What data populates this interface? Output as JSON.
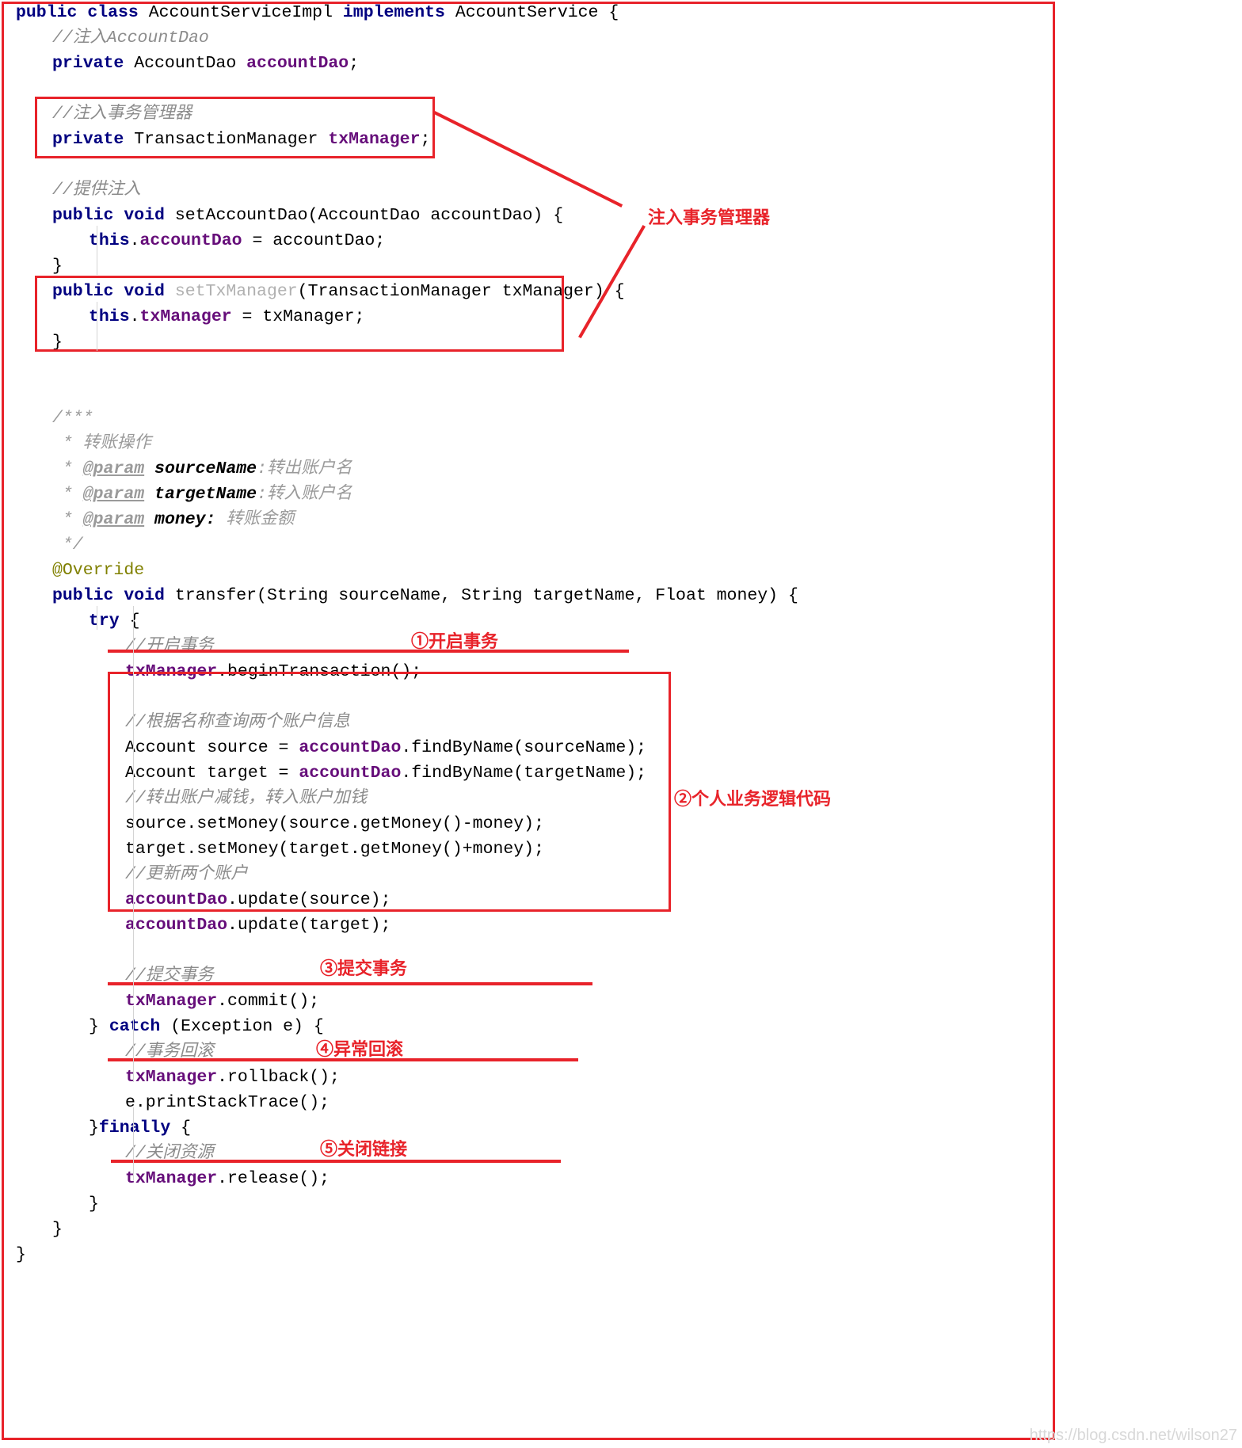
{
  "code_lines": [
    {
      "indent": 0,
      "tokens": [
        {
          "t": "public ",
          "c": "kw"
        },
        {
          "t": "class ",
          "c": "kw"
        },
        {
          "t": "AccountServiceImpl ",
          "c": "plain"
        },
        {
          "t": "implements ",
          "c": "kw"
        },
        {
          "t": "AccountService {",
          "c": "plain"
        }
      ]
    },
    {
      "indent": 1,
      "tokens": [
        {
          "t": "//注入AccountDao",
          "c": "cmt"
        }
      ]
    },
    {
      "indent": 1,
      "tokens": [
        {
          "t": "private ",
          "c": "kw"
        },
        {
          "t": "AccountDao ",
          "c": "plain"
        },
        {
          "t": "accountDao",
          "c": "field"
        },
        {
          "t": ";",
          "c": "plain"
        }
      ]
    },
    {
      "indent": 0,
      "tokens": [
        {
          "t": " ",
          "c": "plain"
        }
      ]
    },
    {
      "indent": 1,
      "tokens": [
        {
          "t": "//注入事务管理器",
          "c": "cmt"
        }
      ]
    },
    {
      "indent": 1,
      "tokens": [
        {
          "t": "private ",
          "c": "kw"
        },
        {
          "t": "TransactionManager ",
          "c": "plain"
        },
        {
          "t": "txManager",
          "c": "field"
        },
        {
          "t": ";",
          "c": "plain"
        }
      ]
    },
    {
      "indent": 0,
      "tokens": [
        {
          "t": " ",
          "c": "plain"
        }
      ]
    },
    {
      "indent": 1,
      "tokens": [
        {
          "t": "//提供注入",
          "c": "cmt"
        }
      ]
    },
    {
      "indent": 1,
      "tokens": [
        {
          "t": "public ",
          "c": "kw"
        },
        {
          "t": "void ",
          "c": "kw"
        },
        {
          "t": "setAccountDao(AccountDao accountDao) {",
          "c": "plain"
        }
      ]
    },
    {
      "indent": 2,
      "tokens": [
        {
          "t": "this",
          "c": "kw"
        },
        {
          "t": ".",
          "c": "plain"
        },
        {
          "t": "accountDao",
          "c": "field"
        },
        {
          "t": " = accountDao;",
          "c": "plain"
        }
      ]
    },
    {
      "indent": 1,
      "tokens": [
        {
          "t": "}",
          "c": "plain"
        }
      ]
    },
    {
      "indent": 1,
      "tokens": [
        {
          "t": "public ",
          "c": "kw"
        },
        {
          "t": "void ",
          "c": "kw"
        },
        {
          "t": "setTxManager",
          "c": "greyed"
        },
        {
          "t": "(TransactionManager txManager) {",
          "c": "plain"
        }
      ]
    },
    {
      "indent": 2,
      "tokens": [
        {
          "t": "this",
          "c": "kw"
        },
        {
          "t": ".",
          "c": "plain"
        },
        {
          "t": "txManager",
          "c": "field"
        },
        {
          "t": " = txManager;",
          "c": "plain"
        }
      ]
    },
    {
      "indent": 1,
      "tokens": [
        {
          "t": "}",
          "c": "plain"
        }
      ]
    },
    {
      "indent": 0,
      "tokens": [
        {
          "t": " ",
          "c": "plain"
        }
      ]
    },
    {
      "indent": 0,
      "tokens": [
        {
          "t": " ",
          "c": "plain"
        }
      ]
    },
    {
      "indent": 1,
      "tokens": [
        {
          "t": "/***",
          "c": "cmtdoc"
        }
      ]
    },
    {
      "indent": 1,
      "tokens": [
        {
          "t": " * 转账操作",
          "c": "cmtdoc"
        }
      ]
    },
    {
      "indent": 1,
      "tokens": [
        {
          "t": " * ",
          "c": "cmtdoc"
        },
        {
          "t": "@param",
          "c": "tag"
        },
        {
          "t": " sourceName",
          "c": "tagtxt"
        },
        {
          "t": ":转出账户名",
          "c": "cmtdoc"
        }
      ]
    },
    {
      "indent": 1,
      "tokens": [
        {
          "t": " * ",
          "c": "cmtdoc"
        },
        {
          "t": "@param",
          "c": "tag"
        },
        {
          "t": " targetName",
          "c": "tagtxt"
        },
        {
          "t": ":转入账户名",
          "c": "cmtdoc"
        }
      ]
    },
    {
      "indent": 1,
      "tokens": [
        {
          "t": " * ",
          "c": "cmtdoc"
        },
        {
          "t": "@param",
          "c": "tag"
        },
        {
          "t": " money:",
          "c": "tagtxt"
        },
        {
          "t": " 转账金额",
          "c": "cmtdoc"
        }
      ]
    },
    {
      "indent": 1,
      "tokens": [
        {
          "t": " */",
          "c": "cmtdoc"
        }
      ]
    },
    {
      "indent": 1,
      "tokens": [
        {
          "t": "@Override",
          "c": "anno"
        }
      ]
    },
    {
      "indent": 1,
      "tokens": [
        {
          "t": "public ",
          "c": "kw"
        },
        {
          "t": "void ",
          "c": "kw"
        },
        {
          "t": "transfer(String sourceName, String targetName, Float money) {",
          "c": "plain"
        }
      ]
    },
    {
      "indent": 2,
      "tokens": [
        {
          "t": "try",
          "c": "kw"
        },
        {
          "t": " {",
          "c": "plain"
        }
      ]
    },
    {
      "indent": 3,
      "tokens": [
        {
          "t": "//开启事务",
          "c": "cmt"
        }
      ]
    },
    {
      "indent": 3,
      "tokens": [
        {
          "t": "txManager",
          "c": "field"
        },
        {
          "t": ".beginTransaction();",
          "c": "plain"
        }
      ]
    },
    {
      "indent": 0,
      "tokens": [
        {
          "t": " ",
          "c": "plain"
        }
      ]
    },
    {
      "indent": 3,
      "tokens": [
        {
          "t": "//根据名称查询两个账户信息",
          "c": "cmt"
        }
      ]
    },
    {
      "indent": 3,
      "tokens": [
        {
          "t": "Account source = ",
          "c": "plain"
        },
        {
          "t": "accountDao",
          "c": "field"
        },
        {
          "t": ".findByName(sourceName);",
          "c": "plain"
        }
      ]
    },
    {
      "indent": 3,
      "tokens": [
        {
          "t": "Account target = ",
          "c": "plain"
        },
        {
          "t": "accountDao",
          "c": "field"
        },
        {
          "t": ".findByName(targetName);",
          "c": "plain"
        }
      ]
    },
    {
      "indent": 3,
      "tokens": [
        {
          "t": "//转出账户减钱，转入账户加钱",
          "c": "cmt"
        }
      ]
    },
    {
      "indent": 3,
      "tokens": [
        {
          "t": "source.setMoney(source.getMoney()-money);",
          "c": "plain"
        }
      ]
    },
    {
      "indent": 3,
      "tokens": [
        {
          "t": "target.setMoney(target.getMoney()+money);",
          "c": "plain"
        }
      ]
    },
    {
      "indent": 3,
      "tokens": [
        {
          "t": "//更新两个账户",
          "c": "cmt"
        }
      ]
    },
    {
      "indent": 3,
      "tokens": [
        {
          "t": "accountDao",
          "c": "field"
        },
        {
          "t": ".update(source);",
          "c": "plain"
        }
      ]
    },
    {
      "indent": 3,
      "tokens": [
        {
          "t": "accountDao",
          "c": "field"
        },
        {
          "t": ".update(target);",
          "c": "plain"
        }
      ]
    },
    {
      "indent": 0,
      "tokens": [
        {
          "t": " ",
          "c": "plain"
        }
      ]
    },
    {
      "indent": 3,
      "tokens": [
        {
          "t": "//提交事务",
          "c": "cmt"
        }
      ]
    },
    {
      "indent": 3,
      "tokens": [
        {
          "t": "txManager",
          "c": "field"
        },
        {
          "t": ".commit();",
          "c": "plain"
        }
      ]
    },
    {
      "indent": 2,
      "tokens": [
        {
          "t": "} ",
          "c": "plain"
        },
        {
          "t": "catch",
          "c": "kw"
        },
        {
          "t": " (Exception e) {",
          "c": "plain"
        }
      ]
    },
    {
      "indent": 3,
      "tokens": [
        {
          "t": "//事务回滚",
          "c": "cmt"
        }
      ]
    },
    {
      "indent": 3,
      "tokens": [
        {
          "t": "txManager",
          "c": "field"
        },
        {
          "t": ".rollback();",
          "c": "plain"
        }
      ]
    },
    {
      "indent": 3,
      "tokens": [
        {
          "t": "e.printStackTrace();",
          "c": "plain"
        }
      ]
    },
    {
      "indent": 2,
      "tokens": [
        {
          "t": "}",
          "c": "plain"
        },
        {
          "t": "finally",
          "c": "kw"
        },
        {
          "t": " {",
          "c": "plain"
        }
      ]
    },
    {
      "indent": 3,
      "tokens": [
        {
          "t": "//关闭资源",
          "c": "cmt"
        }
      ]
    },
    {
      "indent": 3,
      "tokens": [
        {
          "t": "txManager",
          "c": "field"
        },
        {
          "t": ".release();",
          "c": "plain"
        }
      ]
    },
    {
      "indent": 2,
      "tokens": [
        {
          "t": "}",
          "c": "plain"
        }
      ]
    },
    {
      "indent": 1,
      "tokens": [
        {
          "t": "}",
          "c": "plain"
        }
      ]
    },
    {
      "indent": 0,
      "tokens": [
        {
          "t": "}",
          "c": "plain"
        }
      ]
    }
  ],
  "annotations": {
    "inject_tx_manager": "注入事务管理器",
    "step1": "①开启事务",
    "step2": "②个人业务逻辑代码",
    "step3": "③提交事务",
    "step4": "④异常回滚",
    "step5": "⑤关闭链接"
  },
  "colors": {
    "accent_red": "#e8232a",
    "keyword_blue": "#000080",
    "field_purple": "#660e7a",
    "comment_grey": "#8c8c8c",
    "annotation_olive": "#808000"
  },
  "watermark": "https://blog.csdn.net/wilson27"
}
